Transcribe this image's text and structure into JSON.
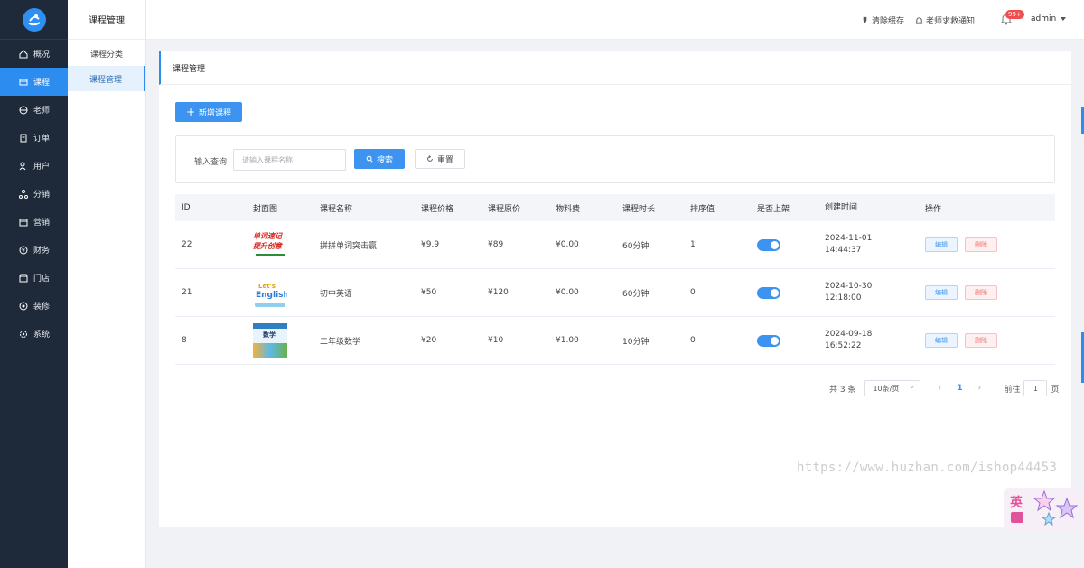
{
  "sidebar": {
    "items": [
      {
        "label": "概况",
        "icon": "home-icon",
        "active": false
      },
      {
        "label": "课程",
        "icon": "course-icon",
        "active": true
      },
      {
        "label": "老师",
        "icon": "teacher-icon",
        "active": false
      },
      {
        "label": "订单",
        "icon": "order-icon",
        "active": false
      },
      {
        "label": "用户",
        "icon": "user-icon",
        "active": false
      },
      {
        "label": "分销",
        "icon": "distribution-icon",
        "active": false
      },
      {
        "label": "营销",
        "icon": "marketing-icon",
        "active": false
      },
      {
        "label": "财务",
        "icon": "finance-icon",
        "active": false
      },
      {
        "label": "门店",
        "icon": "store-icon",
        "active": false
      },
      {
        "label": "装修",
        "icon": "decorate-icon",
        "active": false
      },
      {
        "label": "系统",
        "icon": "system-icon",
        "active": false
      }
    ]
  },
  "subnav": {
    "title": "课程管理",
    "items": [
      {
        "label": "课程分类",
        "active": false
      },
      {
        "label": "课程管理",
        "active": true
      }
    ]
  },
  "header": {
    "clear_cache": "清除缓存",
    "teacher_help": "老师求救通知",
    "badge": "99+",
    "user": "admin"
  },
  "main": {
    "card_title": "课程管理",
    "add_button": "新增课程",
    "search": {
      "label": "输入查询",
      "placeholder": "请输入课程名称",
      "search_button": "搜索",
      "reset_button": "重置"
    },
    "table": {
      "headers": [
        "ID",
        "封面图",
        "课程名称",
        "课程价格",
        "课程原价",
        "物料费",
        "课程时长",
        "排序值",
        "是否上架",
        "创建时间",
        "操作"
      ],
      "rows": [
        {
          "id": "22",
          "name": "拼拼单词突击赢",
          "price": "¥9.9",
          "orig": "¥89",
          "material": "¥0.00",
          "duration": "60分钟",
          "sort": "1",
          "on_shelf": true,
          "date": "2024-11-01",
          "time": "14:44:37",
          "edit": "编辑",
          "delete": "删除"
        },
        {
          "id": "21",
          "name": "初中英语",
          "price": "¥50",
          "orig": "¥120",
          "material": "¥0.00",
          "duration": "60分钟",
          "sort": "0",
          "on_shelf": true,
          "date": "2024-10-30",
          "time": "12:18:00",
          "edit": "编辑",
          "delete": "删除"
        },
        {
          "id": "8",
          "name": "二年级数学",
          "price": "¥20",
          "orig": "¥10",
          "material": "¥1.00",
          "duration": "10分钟",
          "sort": "0",
          "on_shelf": true,
          "date": "2024-09-18",
          "time": "16:52:22",
          "edit": "编辑",
          "delete": "删除"
        }
      ]
    },
    "cover_texts": {
      "cover1_line1": "单词速记",
      "cover1_line2": "提升创意",
      "cover2_line1": "Let's",
      "cover2_line2": "English",
      "cover3": "数学"
    },
    "pagination": {
      "total": "共 3 条",
      "page_size": "10条/页",
      "current": "1",
      "goto_label": "前往",
      "goto_value": "1",
      "goto_suffix": "页"
    }
  },
  "watermark": "https://www.huzhan.com/ishop44453",
  "widget": {
    "label": "英"
  },
  "colors": {
    "accent": "#2d8cf0",
    "sidebar_bg": "#1e2a3a",
    "danger": "#f56c6c"
  }
}
